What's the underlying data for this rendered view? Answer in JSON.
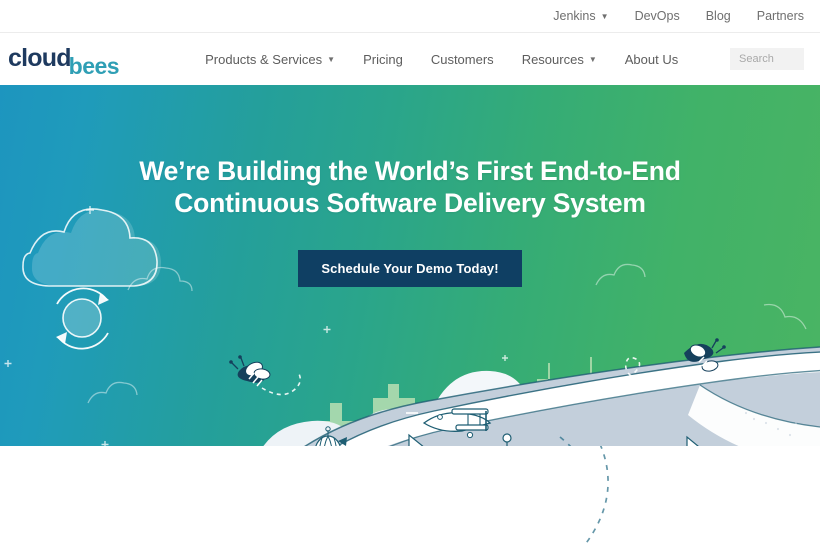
{
  "utility_nav": {
    "items": [
      {
        "label": "Jenkins",
        "has_caret": true,
        "icon": "chevron-down-icon"
      },
      {
        "label": "DevOps",
        "has_caret": false
      },
      {
        "label": "Blog",
        "has_caret": false
      },
      {
        "label": "Partners",
        "has_caret": false
      }
    ]
  },
  "logo": {
    "cloud": "cloud",
    "bees": "bees",
    "cloud_color": "#1e3a5f",
    "bees_color": "#2f9fb5"
  },
  "main_nav": {
    "items": [
      {
        "label": "Products & Services",
        "has_caret": true,
        "icon": "chevron-down-icon"
      },
      {
        "label": "Pricing",
        "has_caret": false
      },
      {
        "label": "Customers",
        "has_caret": false
      },
      {
        "label": "Resources",
        "has_caret": true,
        "icon": "chevron-down-icon"
      },
      {
        "label": "About Us",
        "has_caret": false
      }
    ]
  },
  "search": {
    "placeholder": "Search",
    "value": "",
    "icon": "search-icon"
  },
  "hero": {
    "title": "We’re Building the World’s First End-to-End Continuous Software Delivery System",
    "cta_label": "Schedule Your Demo Today!",
    "cta_bg": "#0f3f63",
    "gradient_start": "#1d95bf",
    "gradient_mid": "#2aa58b",
    "gradient_end": "#4ab463",
    "illustration": {
      "elements": [
        "cloud-refresh-icon",
        "bee-left-icon",
        "bee-right-icon",
        "biplane-icon",
        "hot-air-balloon-icon",
        "robot-arm-icon",
        "city-skyline",
        "winding-road",
        "hills",
        "sparkles",
        "dashed-flight-path"
      ],
      "line_color": "#1e5e73",
      "skyline_color": "#b9e0b3",
      "road_color": "#ffffff",
      "hill_color": "#c3cfdb"
    }
  }
}
